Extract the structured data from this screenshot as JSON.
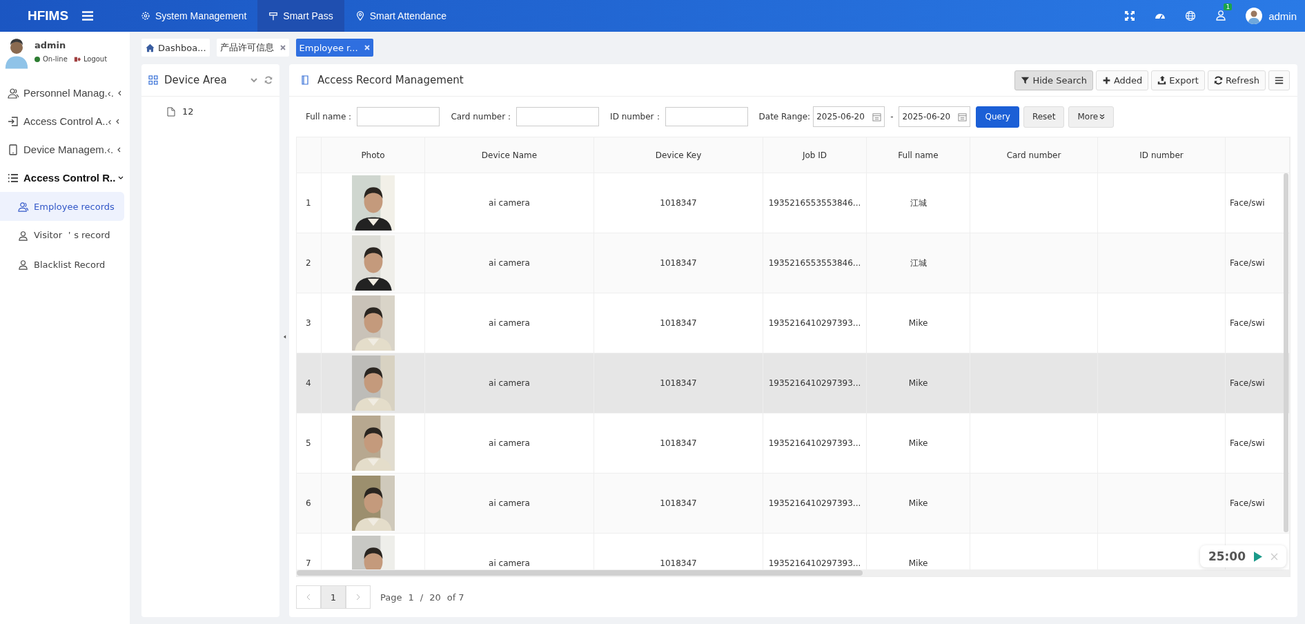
{
  "topbar": {
    "logo": "HFIMS",
    "nav": [
      {
        "label": "System Management",
        "selected": false
      },
      {
        "label": "Smart Pass",
        "selected": true
      },
      {
        "label": "Smart Attendance",
        "selected": false
      }
    ],
    "notification_count": "1",
    "user": "admin"
  },
  "sidebar": {
    "user": {
      "name": "admin",
      "status": "On-line",
      "logout": "Logout"
    },
    "items": [
      {
        "label": "Personnel Manag.‹.",
        "expanded": false
      },
      {
        "label": "Access Control A..‹",
        "expanded": false
      },
      {
        "label": "Device Managem.‹.",
        "expanded": false
      },
      {
        "label": "Access Control R..",
        "expanded": true,
        "children": [
          {
            "label": "Employee records",
            "selected": true
          },
          {
            "label": "Visitor ＇s record",
            "selected": false
          },
          {
            "label": "Blacklist Record",
            "selected": false
          }
        ]
      }
    ]
  },
  "tabs": [
    {
      "label": "Dashboa...",
      "closable": false,
      "selected": false
    },
    {
      "label": "产品许可信息",
      "closable": true,
      "selected": false
    },
    {
      "label": "Employee r...",
      "closable": true,
      "selected": true
    }
  ],
  "device_area": {
    "title": "Device Area",
    "items": [
      "12"
    ]
  },
  "main": {
    "title": "Access Record Management",
    "toolbar": [
      {
        "label": "Hide Search",
        "pressed": true
      },
      {
        "label": "Added",
        "pressed": false
      },
      {
        "label": "Export",
        "pressed": false
      },
      {
        "label": "Refresh",
        "pressed": false
      }
    ],
    "search": {
      "fields": [
        {
          "label": "Full name："
        },
        {
          "label": "Card number："
        },
        {
          "label": "ID number："
        }
      ],
      "date_label": "Date Range:",
      "date_from": "2025-06-20",
      "date_sep": "-",
      "date_to": "2025-06-20",
      "buttons": [
        {
          "label": "Query",
          "kind": "primary"
        },
        {
          "label": "Reset",
          "kind": "default"
        },
        {
          "label": "More",
          "kind": "more"
        }
      ]
    },
    "table": {
      "columns": [
        "Photo",
        "Device Name",
        "Device Key",
        "Job ID",
        "Full name",
        "Card number",
        "ID number"
      ],
      "rows": [
        {
          "index": "1",
          "device_name": "ai camera",
          "device_key": "1018347",
          "job_id": "1935216553553846...",
          "full_name": "江城",
          "column_8": "Face/swi",
          "selected": false
        },
        {
          "index": "2",
          "device_name": "ai camera",
          "device_key": "1018347",
          "job_id": "1935216553553846...",
          "full_name": "江城",
          "column_8": "Face/swi",
          "selected": false
        },
        {
          "index": "3",
          "device_name": "ai camera",
          "device_key": "1018347",
          "job_id": "1935216410297393...",
          "full_name": "Mike",
          "column_8": "Face/swi",
          "selected": false
        },
        {
          "index": "4",
          "device_name": "ai camera",
          "device_key": "1018347",
          "job_id": "1935216410297393...",
          "full_name": "Mike",
          "column_8": "Face/swi",
          "selected": true
        },
        {
          "index": "5",
          "device_name": "ai camera",
          "device_key": "1018347",
          "job_id": "1935216410297393...",
          "full_name": "Mike",
          "column_8": "Face/swi",
          "selected": false
        },
        {
          "index": "6",
          "device_name": "ai camera",
          "device_key": "1018347",
          "job_id": "1935216410297393...",
          "full_name": "Mike",
          "column_8": "Face/swi",
          "selected": false
        },
        {
          "index": "7",
          "device_name": "ai camera",
          "device_key": "1018347",
          "job_id": "1935216410297393...",
          "full_name": "Mike",
          "selected": false
        }
      ]
    },
    "pagination": {
      "current": "1",
      "page_label": "Page",
      "page": "1",
      "slash": "/",
      "size": "20",
      "total": "of 7"
    }
  },
  "timer": "25:00"
}
